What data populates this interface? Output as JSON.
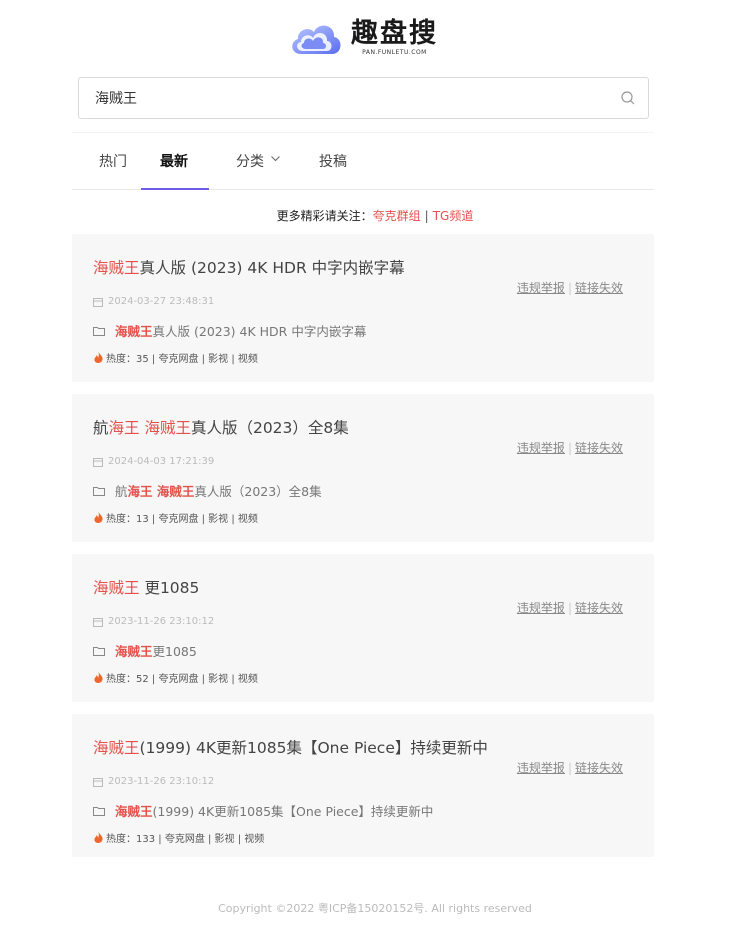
{
  "logo": {
    "title": "趣盘搜",
    "subtitle": "PAN.FUNLETU.COM"
  },
  "search": {
    "value": "海贼王",
    "placeholder": ""
  },
  "tabs": [
    {
      "label": "热门",
      "active": false
    },
    {
      "label": "最新",
      "active": true
    },
    {
      "label": "分类",
      "active": false
    },
    {
      "label": "投稿",
      "active": false
    }
  ],
  "follow": {
    "prefix": "更多精彩请关注：",
    "link1": "夸克群组",
    "separator": "|",
    "link2": "TG频道"
  },
  "results": [
    {
      "title_hl": "海贼王",
      "title_rest": "真人版 (2023) 4K HDR 中字内嵌字幕",
      "date": "2024-03-27 23:48:31",
      "file_prefix": "",
      "file_hl": "海贼王",
      "file_rest": "真人版 (2023) 4K HDR 中字内嵌字幕",
      "meta": "热度：35 | 夸克网盘 | 影视 | 视频"
    },
    {
      "title_pre": "航",
      "title_hl": "海王 海贼王",
      "title_rest": "真人版（2023）全8集",
      "date": "2024-04-03 17:21:39",
      "file_prefix": "航",
      "file_hl": "海王 海贼王",
      "file_rest": "真人版（2023）全8集",
      "meta": "热度：13 | 夸克网盘 | 影视 | 视频"
    },
    {
      "title_pre": "",
      "title_hl": "海贼王",
      "title_rest": " 更1085",
      "date": "2023-11-26 23:10:12",
      "file_prefix": "",
      "file_hl": "海贼王",
      "file_rest": " 更1085",
      "meta": "热度：52 | 夸克网盘 | 影视 | 视频"
    },
    {
      "title_pre": "",
      "title_hl": "海贼王",
      "title_rest": "(1999) 4K更新1085集【One Piece】持续更新中",
      "date": "2023-11-26 23:10:12",
      "file_prefix": "",
      "file_hl": "海贼王",
      "file_rest": "(1999) 4K更新1085集【One Piece】持续更新中",
      "meta": "热度：133 | 夸克网盘 | 影视 | 视频"
    }
  ],
  "card_links": {
    "report": "违规举报",
    "separator": "|",
    "broken": "链接失效"
  },
  "footer": "Copyright ©2022 粤ICP备15020152号. All rights reserved",
  "colors": {
    "highlight": "#e4514a",
    "accent": "#6c5ce7",
    "card_bg": "#f7f7f7"
  },
  "icons": [
    "cloud-logo-icon",
    "search-icon",
    "chevron-down-icon",
    "calendar-icon",
    "folder-icon",
    "fire-icon"
  ]
}
